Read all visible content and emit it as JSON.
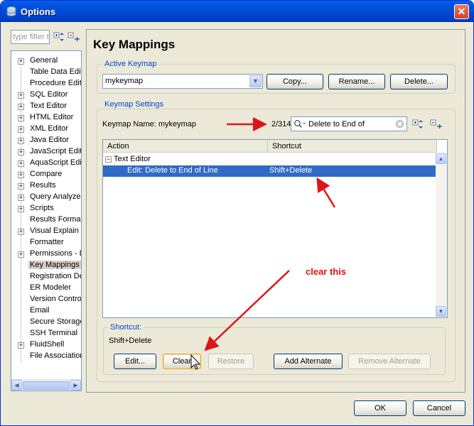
{
  "window": {
    "title": "Options"
  },
  "sidebar": {
    "filter_placeholder": "type filter text",
    "items": [
      {
        "label": "General",
        "expandable": true
      },
      {
        "label": "Table Data Editor",
        "expandable": false
      },
      {
        "label": "Procedure Editor",
        "expandable": false
      },
      {
        "label": "SQL Editor",
        "expandable": true
      },
      {
        "label": "Text Editor",
        "expandable": true
      },
      {
        "label": "HTML Editor",
        "expandable": true
      },
      {
        "label": "XML Editor",
        "expandable": true
      },
      {
        "label": "Java Editor",
        "expandable": true
      },
      {
        "label": "JavaScript Editor",
        "expandable": true
      },
      {
        "label": "AquaScript Editor",
        "expandable": true
      },
      {
        "label": "Compare",
        "expandable": true
      },
      {
        "label": "Results",
        "expandable": true
      },
      {
        "label": "Query Analyzer",
        "expandable": true
      },
      {
        "label": "Scripts",
        "expandable": true
      },
      {
        "label": "Results Format",
        "expandable": false
      },
      {
        "label": "Visual Explain",
        "expandable": true
      },
      {
        "label": "Formatter",
        "expandable": false
      },
      {
        "label": "Permissions - Default",
        "expandable": true
      },
      {
        "label": "Key Mappings",
        "expandable": false,
        "selected": true
      },
      {
        "label": "Registration Defaults",
        "expandable": false
      },
      {
        "label": "ER Modeler",
        "expandable": false
      },
      {
        "label": "Version Control",
        "expandable": false
      },
      {
        "label": "Email",
        "expandable": false
      },
      {
        "label": "Secure Storage",
        "expandable": false
      },
      {
        "label": "SSH Terminal",
        "expandable": false
      },
      {
        "label": "FluidShell",
        "expandable": true
      },
      {
        "label": "File Associations",
        "expandable": false
      }
    ]
  },
  "page": {
    "title": "Key Mappings"
  },
  "active_keymap": {
    "group_label": "Active Keymap",
    "selected": "mykeymap",
    "copy_label": "Copy...",
    "rename_label": "Rename...",
    "delete_label": "Delete..."
  },
  "keymap_settings": {
    "group_label": "Keymap Settings",
    "name_text": "Keymap Name: mykeymap",
    "count": "2/314",
    "search_value": "Delete to End of",
    "columns": [
      "Action",
      "Shortcut"
    ],
    "rows": [
      {
        "action": "Text Editor",
        "shortcut": "",
        "group": true
      },
      {
        "action": "Edit: Delete to End of Line",
        "shortcut": "Shift+Delete",
        "selected": true
      }
    ]
  },
  "shortcut": {
    "group_label": "Shortcut:",
    "value": "Shift+Delete",
    "edit_label": "Edit...",
    "clear_label": "Clear",
    "restore_label": "Restore",
    "add_alt_label": "Add Alternate",
    "remove_alt_label": "Remove Alternate"
  },
  "annotation": {
    "text": "clear this",
    "color": "#e01414"
  },
  "footer": {
    "ok_label": "OK",
    "cancel_label": "Cancel"
  },
  "colors": {
    "titlebar": "#0054e3",
    "selection": "#316ac5",
    "accent_label": "#0046d5"
  }
}
